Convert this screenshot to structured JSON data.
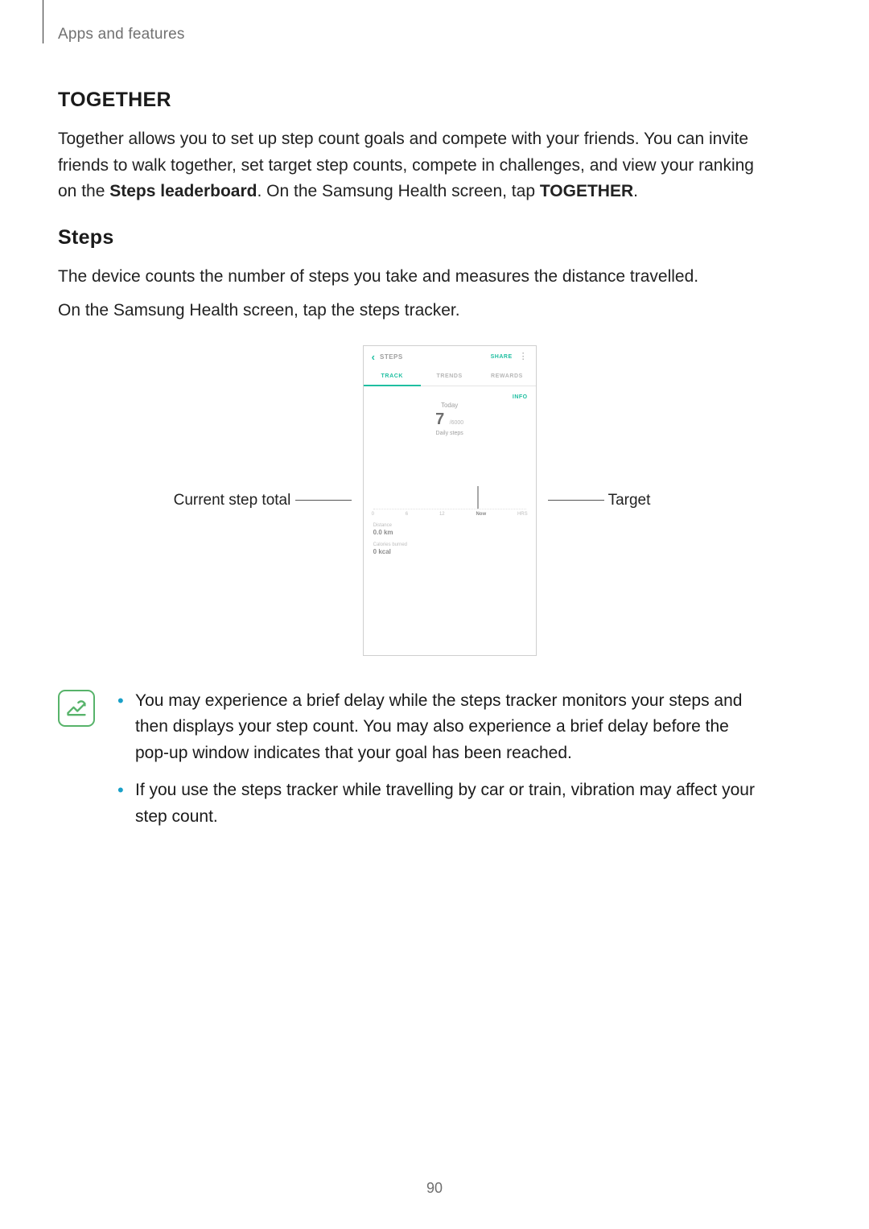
{
  "breadcrumb": "Apps and features",
  "together": {
    "heading": "TOGETHER",
    "para_parts": {
      "p1": "Together allows you to set up step count goals and compete with your friends. You can invite friends to walk together, set target step counts, compete in challenges, and view your ranking on the ",
      "p1_strong": "Steps leaderboard",
      "p2_mid": ". On the Samsung Health screen, tap ",
      "p2_strong": "TOGETHER",
      "p2_end": "."
    }
  },
  "steps": {
    "heading": "Steps",
    "para1": "The device counts the number of steps you take and measures the distance travelled.",
    "para2": "On the Samsung Health screen, tap the steps tracker."
  },
  "callouts": {
    "left": "Current step total",
    "right": "Target"
  },
  "phone": {
    "title": "STEPS",
    "share": "SHARE",
    "tabs": {
      "t1": "TRACK",
      "t2": "TRENDS",
      "t3": "REWARDS"
    },
    "info": "INFO",
    "today": "Today",
    "count_big": "7",
    "count_sub": "/6000",
    "label": "Daily steps",
    "ticks": {
      "a": "0",
      "b": "6",
      "c": "12",
      "d": "Now",
      "e": "HRS"
    },
    "distance_label": "Distance",
    "distance_val": "0.0 km",
    "cal_label": "Calories burned",
    "cal_val": "0 kcal"
  },
  "notes": {
    "n1": "You may experience a brief delay while the steps tracker monitors your steps and then displays your step count. You may also experience a brief delay before the pop-up window indicates that your goal has been reached.",
    "n2": "If you use the steps tracker while travelling by car or train, vibration may affect your step count."
  },
  "page_number": "90",
  "chart_data": {
    "type": "bar",
    "title": "Daily steps",
    "x": [
      0,
      6,
      12,
      "Now"
    ],
    "xlabel": "HRS",
    "ylabel": "Steps",
    "values": [
      0,
      0,
      0,
      7
    ],
    "target": 6000,
    "current_total": 7,
    "ylim": [
      0,
      6000
    ]
  }
}
